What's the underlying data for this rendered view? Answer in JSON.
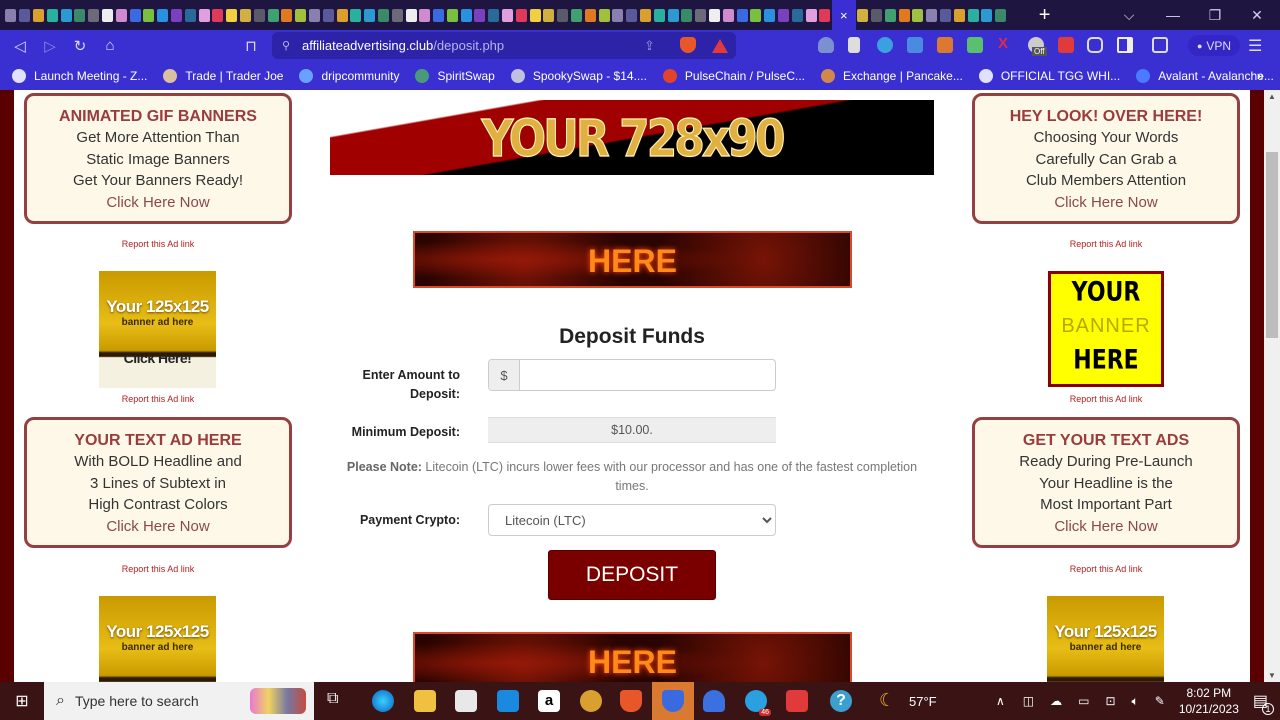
{
  "browser": {
    "tab_close_glyph": "×",
    "new_tab_glyph": "+",
    "tab_count_favicons": 72,
    "window_controls": {
      "dropdown": "⌵",
      "minimize": "—",
      "restore": "❐",
      "close": "✕"
    },
    "nav": {
      "back": "◁",
      "forward": "▷",
      "reload": "↻",
      "home": "⌂",
      "bookmark": "⊓"
    },
    "url": {
      "domain": "affiliateadvertising.club",
      "path": "/deposit.php"
    },
    "vpn_label": "VPN",
    "menu_glyph": "☰",
    "extension_badge": "Off",
    "bookmarks": [
      {
        "label": "Launch Meeting - Z...",
        "icon_color": "#e0e0ff"
      },
      {
        "label": "Trade | Trader Joe",
        "icon_color": "#d9c0a0"
      },
      {
        "label": "dripcommunity",
        "icon_color": "#6aa0ff"
      },
      {
        "label": "SpiritSwap",
        "icon_color": "#4a9a7a"
      },
      {
        "label": "SpookySwap - $14....",
        "icon_color": "#c0c0e0"
      },
      {
        "label": "PulseChain / PulseC...",
        "icon_color": "#e2432a"
      },
      {
        "label": "Exchange | Pancake...",
        "icon_color": "#d1884f"
      },
      {
        "label": "OFFICIAL TGG WHI...",
        "icon_color": "#e0e0ff"
      },
      {
        "label": "Avalant - Avalanche...",
        "icon_color": "#4a7aff"
      }
    ],
    "bookmarks_overflow": "»"
  },
  "page": {
    "left_ads": [
      {
        "headline": "ANIMATED GIF BANNERS",
        "lines": [
          "Get More Attention Than",
          "Static Image Banners",
          "Get Your Banners Ready!"
        ],
        "cta": "Click Here Now"
      },
      {
        "headline": "YOUR TEXT AD HERE",
        "lines": [
          "With BOLD Headline and",
          "3 Lines of Subtext in",
          "High Contrast Colors"
        ],
        "cta": "Click Here Now"
      }
    ],
    "right_ads": [
      {
        "headline": "HEY LOOK! OVER HERE!",
        "lines": [
          "Choosing Your Words",
          "Carefully Can Grab a",
          "Club Members Attention"
        ],
        "cta": "Click Here Now"
      },
      {
        "headline": "GET YOUR TEXT ADS",
        "lines": [
          "Ready During Pre-Launch",
          "Your Headline is the",
          "Most Important Part"
        ],
        "cta": "Click Here Now"
      }
    ],
    "report_link": "Report this Ad link",
    "banner125": {
      "big": "Your 125x125",
      "small": "banner ad here",
      "cta": "Click Here!"
    },
    "yellow_banner": {
      "line1": "YOUR",
      "line2": "BANNER",
      "line3": "HERE"
    },
    "banner728_text": "YOUR 728x90",
    "fire_banner_text": "HERE",
    "form": {
      "title": "Deposit Funds",
      "amount_label": "Enter Amount to Deposit:",
      "amount_addon": "$",
      "amount_value": "",
      "min_label": "Minimum Deposit:",
      "min_value": "$10.00.",
      "note_bold": "Please Note:",
      "note_text": " Litecoin (LTC) incurs lower fees with our processor and has one of the fastest completion times.",
      "crypto_label": "Payment Crypto:",
      "crypto_selected": "Litecoin (LTC)",
      "submit_label": "DEPOSIT"
    }
  },
  "taskbar": {
    "search_placeholder": "Type here to search",
    "weather": "57°F",
    "time": "8:02 PM",
    "date": "10/21/2023",
    "notification_count": "1",
    "telegram_badge": "46"
  }
}
